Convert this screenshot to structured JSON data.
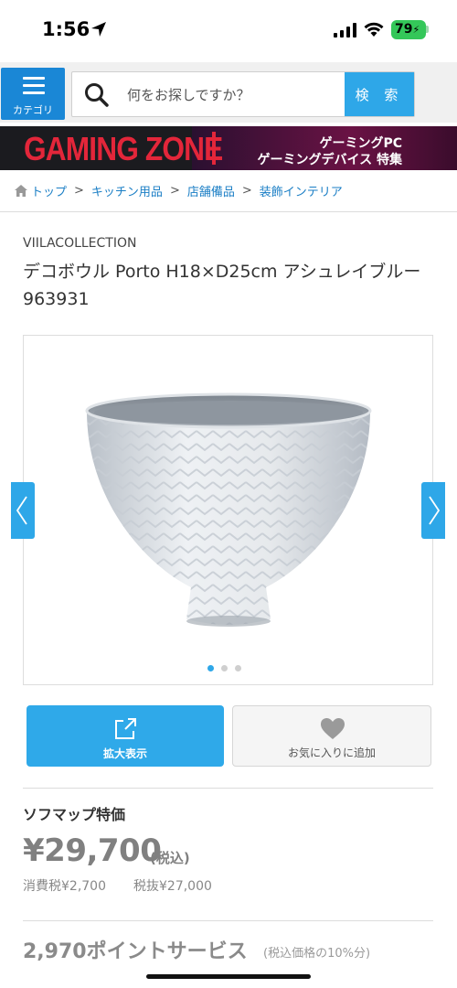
{
  "status_bar": {
    "time": "1:56",
    "battery": "79"
  },
  "header": {
    "category_label": "カテゴリ",
    "search_placeholder": "何をお探しですか？",
    "search_button": "検 索"
  },
  "banner": {
    "logo": "GAMING ZONE",
    "line1": "ゲーミングPC",
    "line2": "ゲーミングデバイス 特集"
  },
  "breadcrumb": [
    "トップ",
    "キッチン用品",
    "店舗備品",
    "装飾インテリア"
  ],
  "product": {
    "brand": "VIILACOLLECTION",
    "title": "デコボウル Porto H18×D25cm アシュレイブルー 963931"
  },
  "gallery": {
    "total_images": 3,
    "active_index": 0
  },
  "actions": {
    "zoom_label": "拡大表示",
    "favorite_label": "お気に入りに追加"
  },
  "pricing": {
    "label": "ソフマップ特価",
    "price": "¥29,700",
    "tax_included": "(税込)",
    "consumption_tax": "消費税¥2,700",
    "price_excl_tax": "税抜¥27,000"
  },
  "points": {
    "label": "2,970ポイントサービス",
    "note": "(税込価格の10%分)"
  },
  "colors": {
    "accent_blue": "#2ea7e8",
    "category_blue": "#1a87d6",
    "link_blue": "#1a7ec5",
    "battery_green": "#34c759",
    "banner_red": "#e3263a"
  }
}
